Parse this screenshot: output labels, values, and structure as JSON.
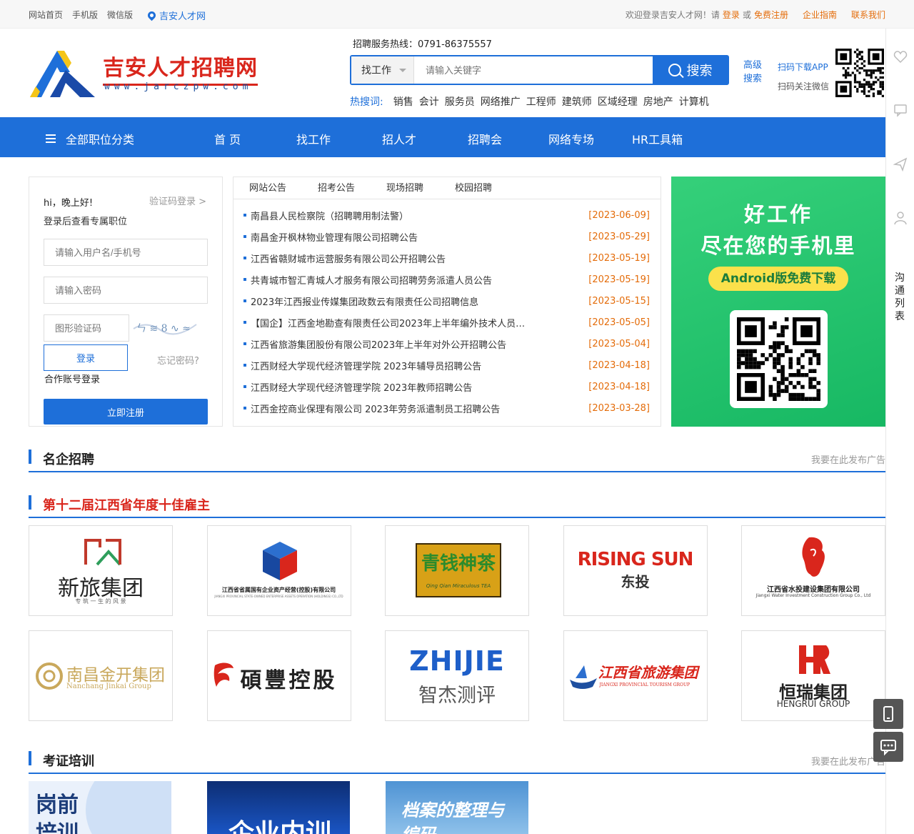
{
  "topbar": {
    "home": "网站首页",
    "mobile": "手机版",
    "wechat": "微信版",
    "location": "吉安人才网",
    "welcome": "欢迎登录吉安人才网！请",
    "login": "登录",
    "or": "或",
    "register": "免费注册",
    "guide": "企业指南",
    "contact": "联系我们"
  },
  "logo": {
    "title": "吉安人才招聘网",
    "domain": "www.jarczpw.com"
  },
  "hotline": "招聘服务热线：0791-86375557",
  "search": {
    "type": "找工作",
    "placeholder": "请输入关键字",
    "button": "搜索",
    "advanced": "高级搜索"
  },
  "hot": {
    "label": "热搜词:",
    "words": [
      "销售",
      "会计",
      "服务员",
      "网络推广",
      "工程师",
      "建筑师",
      "区域经理",
      "房地产",
      "计算机"
    ]
  },
  "app": {
    "download": "扫码下载APP",
    "wechat": "扫码关注微信"
  },
  "nav": {
    "all": "全部职位分类",
    "items": [
      "首 页",
      "找工作",
      "招人才",
      "招聘会",
      "网络专场",
      "HR工具箱"
    ]
  },
  "login": {
    "greeting": "hi，晚上好!",
    "sms": "验证码登录 >",
    "hint": "登录后查看专属职位",
    "user_ph": "请输入用户名/手机号",
    "pwd_ph": "请输入密码",
    "cap_ph": "图形验证码",
    "btn": "登录",
    "forget": "忘记密码?",
    "coop": "合作账号登录",
    "register": "立即注册"
  },
  "news": {
    "tabs": [
      "网站公告",
      "招考公告",
      "现场招聘",
      "校园招聘"
    ],
    "items": [
      {
        "t": "南昌县人民检察院（招聘聘用制法警）",
        "d": "[2023-06-09]"
      },
      {
        "t": "南昌金开枫林物业管理有限公司招聘公告",
        "d": "[2023-05-29]"
      },
      {
        "t": "江西省赣财城市运营服务有限公司公开招聘公告",
        "d": "[2023-05-19]"
      },
      {
        "t": "共青城市智汇青城人才服务有限公司招聘劳务派遣人员公告",
        "d": "[2023-05-19]"
      },
      {
        "t": "2023年江西报业传媒集团政数云有限责任公司招聘信息",
        "d": "[2023-05-15]"
      },
      {
        "t": "【国企】江西金地勘查有限责任公司2023年上半年编外技术人员…",
        "d": "[2023-05-05]"
      },
      {
        "t": "江西省旅游集团股份有限公司2023年上半年对外公开招聘公告",
        "d": "[2023-05-04]"
      },
      {
        "t": "江西财经大学现代经济管理学院 2023年辅导员招聘公告",
        "d": "[2023-04-18]"
      },
      {
        "t": "江西财经大学现代经济管理学院 2023年教师招聘公告",
        "d": "[2023-04-18]"
      },
      {
        "t": "江西金控商业保理有限公司 2023年劳务派遣制员工招聘公告",
        "d": "[2023-03-28]"
      }
    ]
  },
  "banner": {
    "line1": "好工作",
    "line2": "尽在您的手机里",
    "download": "Android版免费下载"
  },
  "sections": {
    "famous": "名企招聘",
    "famous_ad": "我要在此发布广告",
    "top10": "第十二届江西省年度十佳雇主",
    "training": "考证培训",
    "training_ad": "我要在此发布广告"
  },
  "employers_row1": [
    {
      "name": "新旅集团",
      "sub": "专 筑 一 生 的 风 景"
    },
    {
      "name": "江西省省属国有企业资产经营(控股)有限公司",
      "sub": "JIANGXI PROVINCIAL STATE-OWNED ENTERPRISE ASSETS OPERATION (HOLDINGS) CO.,LTD"
    },
    {
      "name": "青钱神茶",
      "sub": "Qing Qian Miraculous TEA"
    },
    {
      "name": "RISING SUN",
      "sub": "东投"
    },
    {
      "name": "江西省水投建设集团有限公司",
      "sub": "Jiangxi Water Investment Construction Group Co., Ltd"
    }
  ],
  "employers_row2": [
    {
      "name": "南昌金开集团",
      "sub": "Nanchang Jinkai Group"
    },
    {
      "name": "碩豐控股",
      "sub": ""
    },
    {
      "name": "ZHIJIE",
      "sub": "智杰测评"
    },
    {
      "name": "江西省旅游集团",
      "sub": "JIANGXI PROVINCIAL TOURISM GROUP"
    },
    {
      "name": "恒瑞集团",
      "sub": "HENGRUI GROUP"
    }
  ],
  "training": [
    "岗前培训",
    "企业内训",
    "档案的整理与编码"
  ],
  "sidebar": {
    "chat": "沟通列表"
  },
  "colors": {
    "brand": "#1e6fd9",
    "accent": "#e46c0a",
    "red": "#d9261c",
    "green": "#1fc26b"
  }
}
